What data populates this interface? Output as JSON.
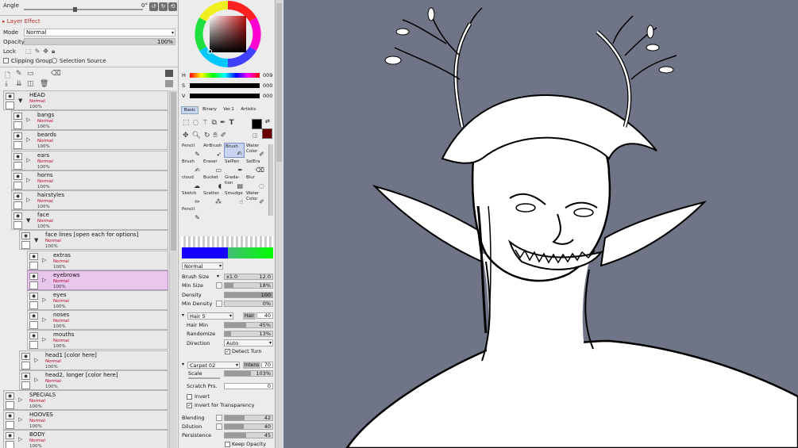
{
  "layer_panel": {
    "angle_label": "Angle",
    "angle_value": "0°",
    "layer_effect_title": "Layer Effect",
    "mode_label": "Mode",
    "mode_value": "Normal",
    "opacity_label": "Opacity",
    "opacity_value": "100%",
    "lock_label": "Lock",
    "clipping_group_label": "Clipping Group",
    "selection_source_label": "Selection Source",
    "layers": [
      {
        "name": "HEAD",
        "mode": "Normal",
        "opacity": "100%",
        "type": "folder",
        "open": true,
        "depth": 0
      },
      {
        "name": "bangs",
        "mode": "Normal",
        "opacity": "100%",
        "type": "folder",
        "open": false,
        "depth": 1
      },
      {
        "name": "beards",
        "mode": "Normal",
        "opacity": "100%",
        "type": "folder",
        "open": false,
        "depth": 1
      },
      {
        "name": "ears",
        "mode": "Normal",
        "opacity": "100%",
        "type": "folder",
        "open": false,
        "depth": 1
      },
      {
        "name": "horns",
        "mode": "Normal",
        "opacity": "100%",
        "type": "folder",
        "open": false,
        "depth": 1
      },
      {
        "name": "hairstyles",
        "mode": "Normal",
        "opacity": "100%",
        "type": "folder",
        "open": false,
        "depth": 1
      },
      {
        "name": "face",
        "mode": "Normal",
        "opacity": "100%",
        "type": "folder",
        "open": true,
        "depth": 1
      },
      {
        "name": "face lines [open each for options]",
        "mode": "Normal",
        "opacity": "100%",
        "type": "folder",
        "open": true,
        "depth": 2
      },
      {
        "name": "extras",
        "mode": "Normal",
        "opacity": "100%",
        "type": "folder",
        "open": false,
        "depth": 3
      },
      {
        "name": "eyebrows",
        "mode": "Normal",
        "opacity": "100%",
        "type": "folder",
        "open": false,
        "depth": 3,
        "selected": true
      },
      {
        "name": "eyes",
        "mode": "Normal",
        "opacity": "100%",
        "type": "folder",
        "open": false,
        "depth": 3
      },
      {
        "name": "noses",
        "mode": "Normal",
        "opacity": "100%",
        "type": "folder",
        "open": false,
        "depth": 3
      },
      {
        "name": "mouths",
        "mode": "Normal",
        "opacity": "100%",
        "type": "folder",
        "open": false,
        "depth": 3
      },
      {
        "name": "head1 [color here]",
        "mode": "Normal",
        "opacity": "100%",
        "type": "folder",
        "open": false,
        "depth": 2
      },
      {
        "name": "head2, longer [color here]",
        "mode": "Normal",
        "opacity": "100%",
        "type": "folder",
        "open": false,
        "depth": 2
      },
      {
        "name": "SPECIALS",
        "mode": "Normal",
        "opacity": "100%",
        "type": "folder",
        "open": false,
        "depth": 0
      },
      {
        "name": "HOOVES",
        "mode": "Normal",
        "opacity": "100%",
        "type": "folder",
        "open": false,
        "depth": 0
      },
      {
        "name": "BODY",
        "mode": "Normal",
        "opacity": "100%",
        "type": "folder",
        "open": false,
        "depth": 0
      }
    ]
  },
  "color_panel": {
    "h_label": "H",
    "h_value": "009",
    "s_label": "S",
    "s_value": "000",
    "v_label": "V",
    "v_value": "000",
    "tabs": [
      "Basic",
      "Binary",
      "Ver.1",
      "Artistic"
    ],
    "foreground_color": "#000000",
    "background_color": "#6a0000"
  },
  "tools": [
    {
      "label": "Pencil",
      "icon": "pencil-icon"
    },
    {
      "label": "AirBrush",
      "icon": "airbrush-icon"
    },
    {
      "label": "Brush",
      "icon": "brush-icon",
      "active": true
    },
    {
      "label": "Water Color",
      "icon": "watercolor-icon"
    },
    {
      "label": "Brush",
      "icon": "brush-icon"
    },
    {
      "label": "Eraser",
      "icon": "eraser-icon"
    },
    {
      "label": "SelPen",
      "icon": "selpen-icon"
    },
    {
      "label": "SelEra",
      "icon": "selera-icon"
    },
    {
      "label": "cloud",
      "icon": "cloud-icon"
    },
    {
      "label": "Bucket",
      "icon": "bucket-icon"
    },
    {
      "label": "Grada-tion",
      "icon": "gradation-icon"
    },
    {
      "label": "Blur",
      "icon": "blur-icon"
    },
    {
      "label": "Sketch",
      "icon": "sketch-icon"
    },
    {
      "label": "Scatter",
      "icon": "scatter-icon"
    },
    {
      "label": "Smudge",
      "icon": "smudge-icon"
    },
    {
      "label": "Water Color",
      "icon": "watercolor-icon"
    },
    {
      "label": "Pencil",
      "icon": "pencil-icon"
    }
  ],
  "brush_props": {
    "blend_mode": "Normal",
    "brush_size_label": "Brush Size",
    "brush_size_mult": "x1.0",
    "brush_size_value": "12.0",
    "min_size_label": "Min Size",
    "min_size_value": "18%",
    "min_size_fraction": 0.18,
    "density_label": "Density",
    "density_value": "100",
    "density_fraction": 1.0,
    "min_density_label": "Min Density",
    "min_density_value": "0%",
    "min_density_fraction": 0.0,
    "brush_shape": "Hair 5",
    "hair_label": "Hair",
    "hair_value": "40",
    "hair_min_label": "Hair Min",
    "hair_min_value": "45%",
    "hair_min_fraction": 0.45,
    "randomize_label": "Randomize",
    "randomize_value": "13%",
    "randomize_fraction": 0.13,
    "direction_label": "Direction",
    "direction_value": "Auto",
    "detect_turn_label": "Detect Turn",
    "texture": "Carpet 02",
    "intens_label": "Intens",
    "intens_value": "70",
    "scale_label": "Scale",
    "scale_value": "103%",
    "scale_fraction": 0.55,
    "scratch_label": "Scratch Prs.",
    "scratch_value": "0",
    "invert_label": "Invert",
    "invert_transparency_label": "Invert for Transparency",
    "blending_label": "Blending",
    "blending_value": "42",
    "blending_fraction": 0.42,
    "dilution_label": "Dilution",
    "dilution_value": "40",
    "dilution_fraction": 0.4,
    "persistence_label": "Persistence",
    "persistence_value": "45",
    "persistence_fraction": 0.45,
    "keep_opacity_label": "Keep Opacity"
  }
}
